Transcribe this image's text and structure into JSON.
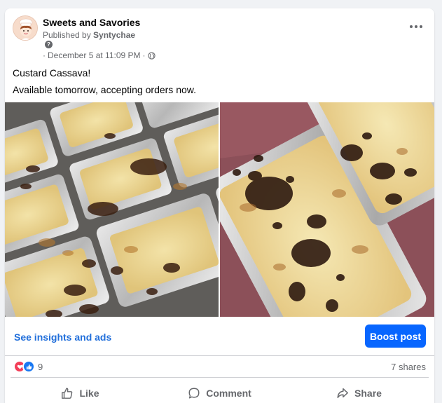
{
  "post": {
    "page_name": "Sweets and Savories",
    "published_prefix": "Published by ",
    "published_by": "Syntychae",
    "help_mark": "?",
    "timestamp": "December 5 at 11:09 PM",
    "separator_before": "·",
    "separator_after": "·",
    "audience_icon": "globe-icon",
    "text_lines": [
      "Custard Cassava!",
      "Available tomorrow, accepting orders now."
    ],
    "photos": [
      "custard-cassava-trays-photo",
      "custard-cassava-closeup-photo"
    ]
  },
  "insights": {
    "link_label": "See insights and ads",
    "boost_label": "Boost post"
  },
  "reactions": {
    "icons": [
      "love-reaction-icon",
      "like-reaction-icon"
    ],
    "count": "9",
    "shares": "7 shares"
  },
  "actions": {
    "like": "Like",
    "comment": "Comment",
    "share": "Share"
  },
  "colors": {
    "accent": "#0866ff",
    "link": "#216fdb",
    "secondary_text": "#65676b",
    "love": "#f33e58",
    "like": "#1877f2"
  }
}
